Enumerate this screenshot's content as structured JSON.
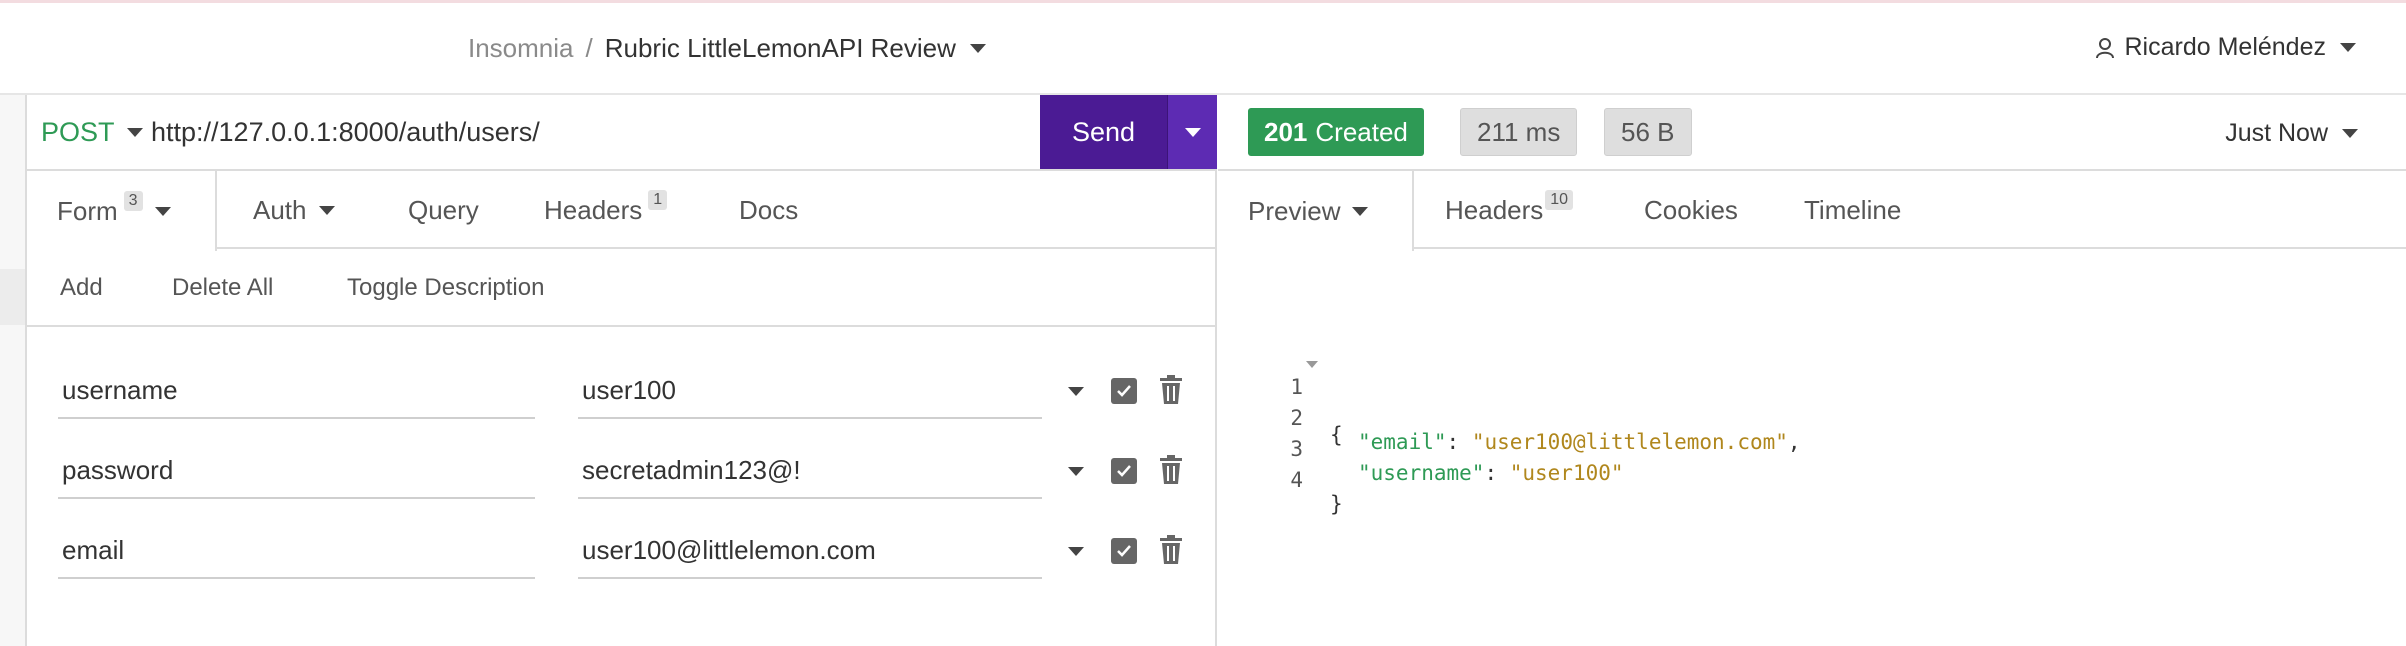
{
  "breadcrumb": {
    "app": "Insomnia",
    "separator": "/",
    "workspace": "Rubric LittleLemonAPI Review"
  },
  "user": {
    "name": "Ricardo Meléndez"
  },
  "request": {
    "method": "POST",
    "url": "http://127.0.0.1:8000/auth/users/",
    "send_label": "Send",
    "tabs": [
      {
        "label": "Form",
        "badge": "3"
      },
      {
        "label": "Auth"
      },
      {
        "label": "Query"
      },
      {
        "label": "Headers",
        "badge": "1"
      },
      {
        "label": "Docs"
      }
    ],
    "actions": {
      "add": "Add",
      "delete_all": "Delete All",
      "toggle": "Toggle Description"
    },
    "form_rows": [
      {
        "name": "username",
        "value": "user100"
      },
      {
        "name": "password",
        "value": "secretadmin123@!"
      },
      {
        "name": "email",
        "value": "user100@littlelemon.com"
      }
    ]
  },
  "response": {
    "status_code": "201",
    "status_text": "Created",
    "time": "211 ms",
    "size": "56 B",
    "when": "Just Now",
    "tabs": [
      {
        "label": "Preview"
      },
      {
        "label": "Headers",
        "badge": "10"
      },
      {
        "label": "Cookies"
      },
      {
        "label": "Timeline"
      }
    ],
    "body_lines": [
      {
        "n": "1",
        "open": "{"
      },
      {
        "n": "2",
        "key": "\"email\"",
        "colon": ": ",
        "val": "\"user100@littlelemon.com\"",
        "comma": ","
      },
      {
        "n": "3",
        "key": "\"username\"",
        "colon": ": ",
        "val": "\"user100\""
      },
      {
        "n": "4",
        "close": "}"
      }
    ]
  },
  "colors": {
    "method": "#2e9a55",
    "send": "#4b1b94",
    "status_ok": "#2e9a55",
    "json_key": "#2e9a55",
    "json_string": "#b0871d"
  }
}
